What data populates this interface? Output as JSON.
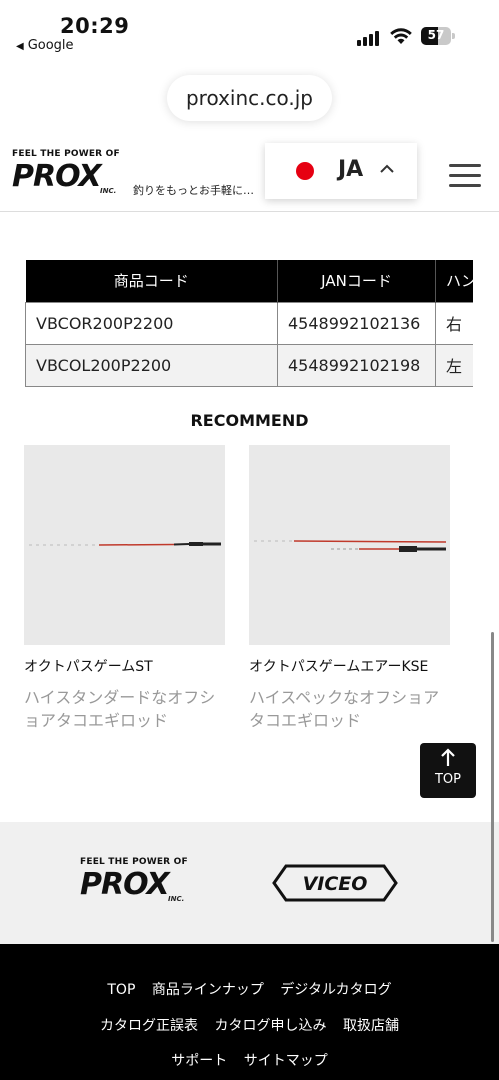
{
  "status_bar": {
    "time": "20:29",
    "back_app": "Google",
    "battery": "57",
    "battery_level": 0.57
  },
  "browser": {
    "url": "proxinc.co.jp"
  },
  "header": {
    "logo_tagline": "FEEL THE POWER OF",
    "logo_text": "PROX",
    "logo_inc": "INC.",
    "site_tagline": "釣りをもっとお手軽に…",
    "language": "JA",
    "accent_color": "#e60012"
  },
  "product_table": {
    "headers": [
      "商品コード",
      "JANコード",
      "ハン"
    ],
    "rows": [
      [
        "VBCOR200P2200",
        "4548992102136",
        "右"
      ],
      [
        "VBCOL200P2200",
        "4548992102198",
        "左"
      ]
    ]
  },
  "recommend": {
    "title": "RECOMMEND",
    "items": [
      {
        "name": "オクトパスゲームST",
        "desc": "ハイスタンダードなオフショアタコエギロッド"
      },
      {
        "name": "オクトパスゲームエアーKSE",
        "desc": "ハイスペックなオフショアタコエギロッド"
      }
    ]
  },
  "top_button": {
    "label": "TOP"
  },
  "footer": {
    "logo_tagline": "FEEL THE POWER OF",
    "logo_text": "PROX",
    "logo_inc": "INC.",
    "brand2": "VICEO",
    "nav": [
      [
        "TOP",
        "商品ラインナップ",
        "デジタルカタログ"
      ],
      [
        "カタログ正誤表",
        "カタログ申し込み",
        "取扱店舗"
      ],
      [
        "サポート",
        "サイトマップ"
      ]
    ]
  }
}
